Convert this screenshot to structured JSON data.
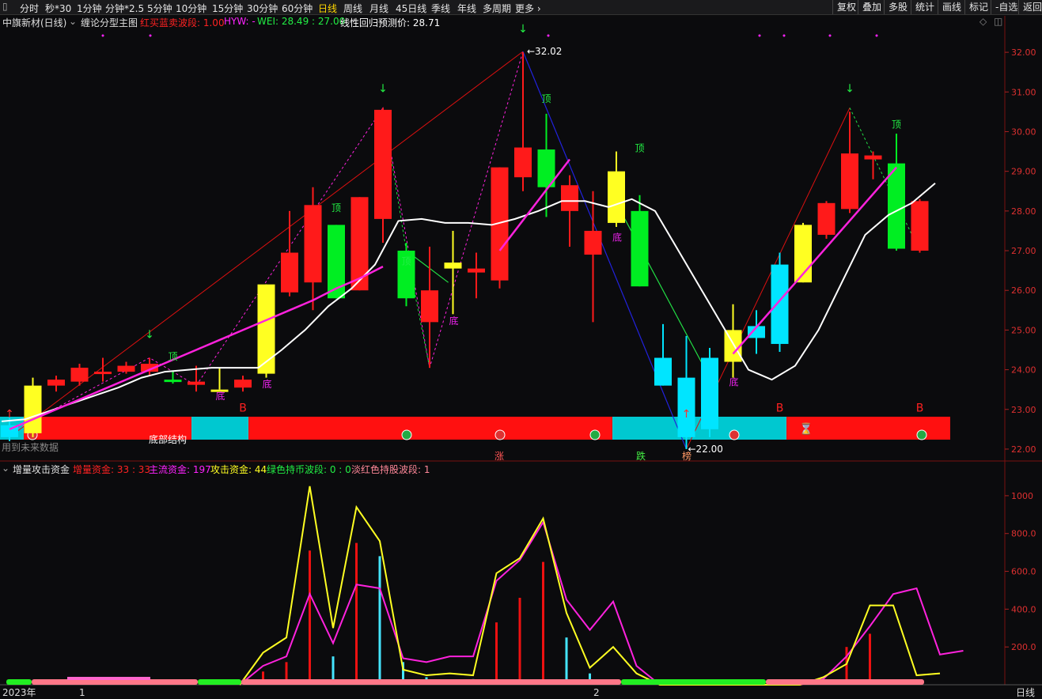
{
  "toolbar": {
    "items": [
      "分时",
      "秒*30",
      "1分钟",
      "分钟*2.5",
      "5分钟",
      "10分钟",
      "15分钟",
      "30分钟",
      "60分钟",
      "日线",
      "周线",
      "月线",
      "45日线",
      "季线",
      "年线",
      "多周期",
      "更多 ›"
    ],
    "right_items": [
      "复权",
      "叠加",
      "多股",
      "统计",
      "画线",
      "标记",
      "-自选",
      "返回"
    ]
  },
  "main_info": {
    "title": "中旗新材(日线)",
    "indicator": "缠论分型主图",
    "red_green": "红买蓝卖波段: 1.00",
    "hyw": "HYW: -",
    "wei": "WEI: 28.49 : 27.00",
    "regression": "线性回归预测价: 28.71"
  },
  "sub_info": {
    "title": "增量攻击资金",
    "incr": "增量资金: 33 : 33",
    "main_fund": "主流资金: 197",
    "attack": "攻击资金: 44",
    "green_hold": "绿色持币波段: 0 : 0",
    "red_hold": "淡红色持股波段: 1"
  },
  "annotations": {
    "bottom_structure": "底部结构",
    "future_data": "用到未来数据",
    "high_label": "32.02",
    "low_label": "22.00",
    "top": "顶",
    "bottom": "底",
    "buy": "B",
    "zhang": "涨",
    "die": "跌",
    "bang": "榜"
  },
  "x_axis": {
    "year": "2023年",
    "month1": "1",
    "month2": "2",
    "period": "日线"
  },
  "colors": {
    "up_red": "#ff1a1a",
    "down_green": "#00ee22",
    "yellow": "#ffff22",
    "cyan": "#00e5ff",
    "magenta": "#ff22dd",
    "white": "#ffffff"
  },
  "chart_data": [
    {
      "type": "candlestick",
      "title": "中旗新材(日线)",
      "ylim": [
        21.7,
        32.6
      ],
      "y_ticks": [
        22.0,
        23.0,
        24.0,
        25.0,
        26.0,
        27.0,
        28.0,
        29.0,
        30.0,
        31.0,
        32.0
      ],
      "candles": [
        {
          "o": 22.3,
          "c": 22.6,
          "h": 22.8,
          "l": 22.2,
          "color": "cyan"
        },
        {
          "o": 22.4,
          "c": 23.6,
          "h": 23.8,
          "l": 22.3,
          "color": "yellow"
        },
        {
          "o": 23.6,
          "c": 23.75,
          "h": 23.85,
          "l": 23.45,
          "color": "red"
        },
        {
          "o": 23.7,
          "c": 24.05,
          "h": 24.15,
          "l": 23.6,
          "color": "red"
        },
        {
          "o": 23.9,
          "c": 23.95,
          "h": 24.3,
          "l": 23.7,
          "color": "red"
        },
        {
          "o": 23.95,
          "c": 24.1,
          "h": 24.2,
          "l": 23.9,
          "color": "red"
        },
        {
          "o": 23.95,
          "c": 24.15,
          "h": 24.3,
          "l": 23.85,
          "color": "red"
        },
        {
          "o": 23.75,
          "c": 23.7,
          "h": 23.95,
          "l": 23.65,
          "color": "green"
        },
        {
          "o": 23.7,
          "c": 23.62,
          "h": 24.1,
          "l": 23.45,
          "color": "red"
        },
        {
          "o": 23.5,
          "c": 23.5,
          "h": 24.05,
          "l": 23.5,
          "color": "yellow"
        },
        {
          "o": 23.55,
          "c": 23.75,
          "h": 23.85,
          "l": 23.45,
          "color": "red"
        },
        {
          "o": 23.9,
          "c": 26.15,
          "h": 26.15,
          "l": 23.8,
          "color": "yellow"
        },
        {
          "o": 25.95,
          "c": 26.95,
          "h": 28.0,
          "l": 25.85,
          "color": "red"
        },
        {
          "o": 26.2,
          "c": 28.15,
          "h": 28.6,
          "l": 25.5,
          "color": "red"
        },
        {
          "o": 27.65,
          "c": 25.8,
          "h": 27.65,
          "l": 25.8,
          "color": "green"
        },
        {
          "o": 26.0,
          "c": 28.35,
          "h": 28.35,
          "l": 26.0,
          "color": "red"
        },
        {
          "o": 27.8,
          "c": 30.55,
          "h": 30.6,
          "l": 27.2,
          "color": "red"
        },
        {
          "o": 27.0,
          "c": 25.8,
          "h": 27.2,
          "l": 25.6,
          "color": "green"
        },
        {
          "o": 25.2,
          "c": 26.0,
          "h": 27.1,
          "l": 24.05,
          "color": "red"
        },
        {
          "o": 26.55,
          "c": 26.7,
          "h": 27.5,
          "l": 25.4,
          "color": "yellow"
        },
        {
          "o": 26.45,
          "c": 26.55,
          "h": 26.95,
          "l": 25.8,
          "color": "red"
        },
        {
          "o": 26.25,
          "c": 29.1,
          "h": 29.1,
          "l": 26.05,
          "color": "red"
        },
        {
          "o": 28.85,
          "c": 29.6,
          "h": 32.0,
          "l": 28.5,
          "color": "red"
        },
        {
          "o": 29.55,
          "c": 28.6,
          "h": 30.45,
          "l": 27.85,
          "color": "green"
        },
        {
          "o": 28.0,
          "c": 28.65,
          "h": 28.9,
          "l": 27.1,
          "color": "red"
        },
        {
          "o": 26.9,
          "c": 27.5,
          "h": 28.5,
          "l": 25.2,
          "color": "red"
        },
        {
          "o": 27.7,
          "c": 29.0,
          "h": 29.5,
          "l": 27.6,
          "color": "yellow"
        },
        {
          "o": 28.0,
          "c": 26.1,
          "h": 28.4,
          "l": 26.1,
          "color": "green"
        },
        {
          "o": 23.6,
          "c": 24.3,
          "h": 25.15,
          "l": 23.6,
          "color": "cyan"
        },
        {
          "o": 22.3,
          "c": 23.8,
          "h": 24.85,
          "l": 22.0,
          "color": "cyan"
        },
        {
          "o": 22.5,
          "c": 24.3,
          "h": 24.55,
          "l": 22.3,
          "color": "cyan"
        },
        {
          "o": 24.2,
          "c": 25.0,
          "h": 25.65,
          "l": 23.8,
          "color": "yellow"
        },
        {
          "o": 24.8,
          "c": 25.1,
          "h": 25.5,
          "l": 24.4,
          "color": "cyan"
        },
        {
          "o": 24.65,
          "c": 26.65,
          "h": 26.95,
          "l": 24.45,
          "color": "cyan"
        },
        {
          "o": 26.2,
          "c": 27.65,
          "h": 27.7,
          "l": 26.2,
          "color": "yellow"
        },
        {
          "o": 27.4,
          "c": 28.2,
          "h": 28.25,
          "l": 27.3,
          "color": "red"
        },
        {
          "o": 28.05,
          "c": 29.45,
          "h": 30.5,
          "l": 27.95,
          "color": "red"
        },
        {
          "o": 29.3,
          "c": 29.4,
          "h": 29.5,
          "l": 28.8,
          "color": "red"
        },
        {
          "o": 29.2,
          "c": 27.05,
          "h": 29.95,
          "l": 27.0,
          "color": "green"
        },
        {
          "o": 27.0,
          "c": 28.25,
          "h": 28.3,
          "l": 26.95,
          "color": "red"
        }
      ],
      "ma_white": [
        22.7,
        22.75,
        22.95,
        23.15,
        23.35,
        23.55,
        23.8,
        23.95,
        24.0,
        24.05,
        24.05,
        24.05,
        24.5,
        25.0,
        25.6,
        26.05,
        26.65,
        27.75,
        27.8,
        27.7,
        27.7,
        27.65,
        27.8,
        28.0,
        28.25,
        28.25,
        28.1,
        28.3,
        28.0,
        27.0,
        26.0,
        25.0,
        24.0,
        23.75,
        24.1,
        25.0,
        26.2,
        27.4,
        27.9,
        28.2,
        28.7
      ],
      "ma_magenta": [
        22.5,
        22.75,
        23.0,
        23.25,
        23.5,
        23.75,
        24.0,
        24.25,
        24.5,
        24.75,
        25.0,
        25.25,
        25.5,
        25.75,
        26.05,
        26.3,
        26.6,
        26.9,
        27.15,
        27.45,
        27.75,
        28.05,
        28.35,
        28.65,
        28.95,
        29.25
      ],
      "y_label_high": 32.02,
      "y_label_low": 22.0
    },
    {
      "type": "line",
      "title": "增量攻击资金",
      "ylim": [
        0,
        1100
      ],
      "y_ticks": [
        200.0,
        400.0,
        600.0,
        800.0,
        1000
      ],
      "series": [
        {
          "name": "主流资金",
          "color": "magenta",
          "values": [
            0,
            0,
            0,
            0,
            0,
            0,
            0,
            0,
            0,
            0,
            0,
            100,
            150,
            480,
            220,
            530,
            510,
            140,
            120,
            150,
            150,
            550,
            660,
            860,
            450,
            290,
            440,
            100,
            0,
            0,
            0,
            0,
            0,
            0,
            0,
            30,
            150,
            310,
            480,
            510,
            160,
            180
          ]
        },
        {
          "name": "攻击资金",
          "color": "yellow",
          "values": [
            0,
            0,
            0,
            0,
            0,
            0,
            0,
            0,
            0,
            0,
            0,
            170,
            250,
            1050,
            300,
            940,
            760,
            80,
            50,
            60,
            50,
            590,
            670,
            880,
            380,
            90,
            200,
            60,
            0,
            0,
            0,
            0,
            0,
            0,
            0,
            40,
            110,
            420,
            420,
            50,
            60
          ]
        }
      ],
      "bars_red": [
        0,
        0,
        0,
        0,
        0,
        0,
        0,
        0,
        0,
        0,
        0,
        70,
        120,
        710,
        0,
        750,
        0,
        0,
        0,
        0,
        0,
        330,
        460,
        650,
        0,
        0,
        0,
        0,
        0,
        0,
        0,
        0,
        0,
        0,
        0,
        25,
        200,
        270,
        0,
        0
      ],
      "bars_cyan": [
        0,
        0,
        0,
        0,
        0,
        0,
        0,
        0,
        0,
        0,
        0,
        0,
        0,
        0,
        150,
        0,
        680,
        120,
        40,
        0,
        30,
        0,
        0,
        0,
        250,
        60,
        0,
        0,
        0,
        0,
        0,
        0,
        0,
        0,
        0,
        0,
        0,
        0,
        0,
        0
      ]
    }
  ]
}
